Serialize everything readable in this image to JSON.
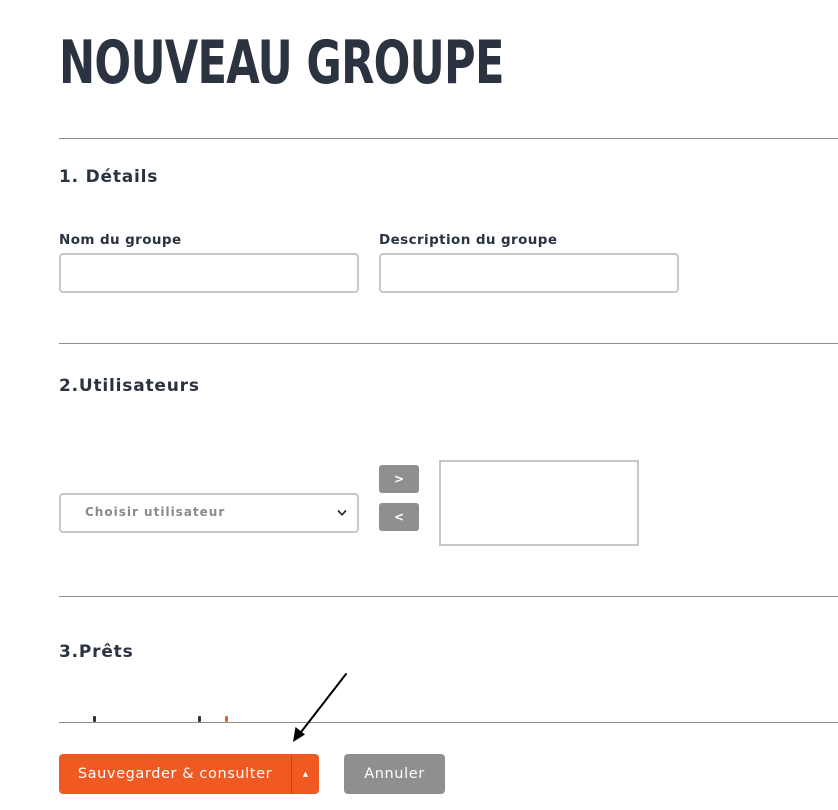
{
  "page": {
    "title": "NOUVEAU GROUPE"
  },
  "sections": {
    "details": {
      "title": "1. Détails",
      "group_name_label": "Nom du groupe",
      "group_name_value": "",
      "group_description_label": "Description du groupe",
      "group_description_value": ""
    },
    "users": {
      "title": "2.Utilisateurs",
      "select_value": "Choisir utilisateur",
      "add_icon": "chevron-right-icon",
      "add_label": ">",
      "remove_icon": "chevron-left-icon",
      "remove_label": "<",
      "selected_users": []
    },
    "loans": {
      "title": "3.Prêts"
    }
  },
  "footer": {
    "save_label": "Sauvegarder & consulter",
    "save_menu_icon": "caret-up-icon",
    "save_menu_glyph": "▲",
    "cancel_label": "Annuler"
  },
  "colors": {
    "primary": "#f05a22",
    "secondary_button": "#8f8f8f",
    "heading": "#2b3340",
    "border": "#c8c8c8"
  }
}
